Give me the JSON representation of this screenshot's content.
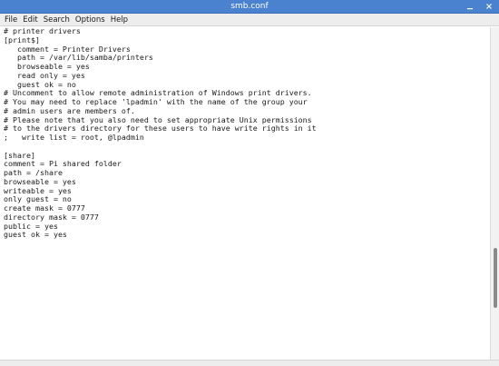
{
  "window": {
    "title": "smb.conf",
    "minimize_glyph": "–",
    "close_glyph": "✕"
  },
  "menu": [
    "File",
    "Edit",
    "Search",
    "Options",
    "Help"
  ],
  "editor": {
    "lines": [
      "# printer drivers",
      "[print$]",
      "   comment = Printer Drivers",
      "   path = /var/lib/samba/printers",
      "   browseable = yes",
      "   read only = yes",
      "   guest ok = no",
      "# Uncomment to allow remote administration of Windows print drivers.",
      "# You may need to replace 'lpadmin' with the name of the group your",
      "# admin users are members of.",
      "# Please note that you also need to set appropriate Unix permissions",
      "# to the drivers directory for these users to have write rights in it",
      ";   write list = root, @lpadmin",
      "",
      "[share]",
      "comment = Pi shared folder",
      "path = /share",
      "browseable = yes",
      "writeable = yes",
      "only guest = no",
      "create mask = 0777",
      "directory mask = 0777",
      "public = yes",
      "guest ok = yes"
    ]
  },
  "scrollbar": {
    "position_fraction": 0.82
  }
}
